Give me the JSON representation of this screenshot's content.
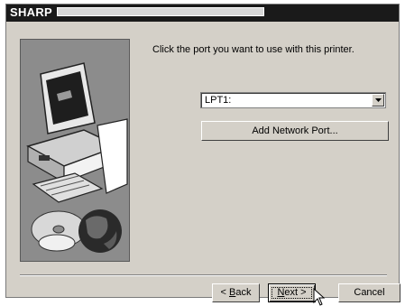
{
  "window": {
    "brand": "SHARP",
    "title_progress": 0.0
  },
  "wizard": {
    "instruction": "Click the port you want to use with this printer.",
    "port_select": {
      "value": "LPT1:"
    },
    "add_network_port_label": "Add Network Port..."
  },
  "footer": {
    "back": {
      "mnemonic": "B",
      "rest": "ack",
      "prefix": "< "
    },
    "next": {
      "mnemonic": "N",
      "rest": "ext",
      "suffix": " >"
    },
    "cancel_label": "Cancel"
  },
  "icons": {
    "art": "computer-cd-globe-illustration",
    "dropdown": "chevron-down-icon",
    "cursor": "mouse-pointer-icon"
  }
}
